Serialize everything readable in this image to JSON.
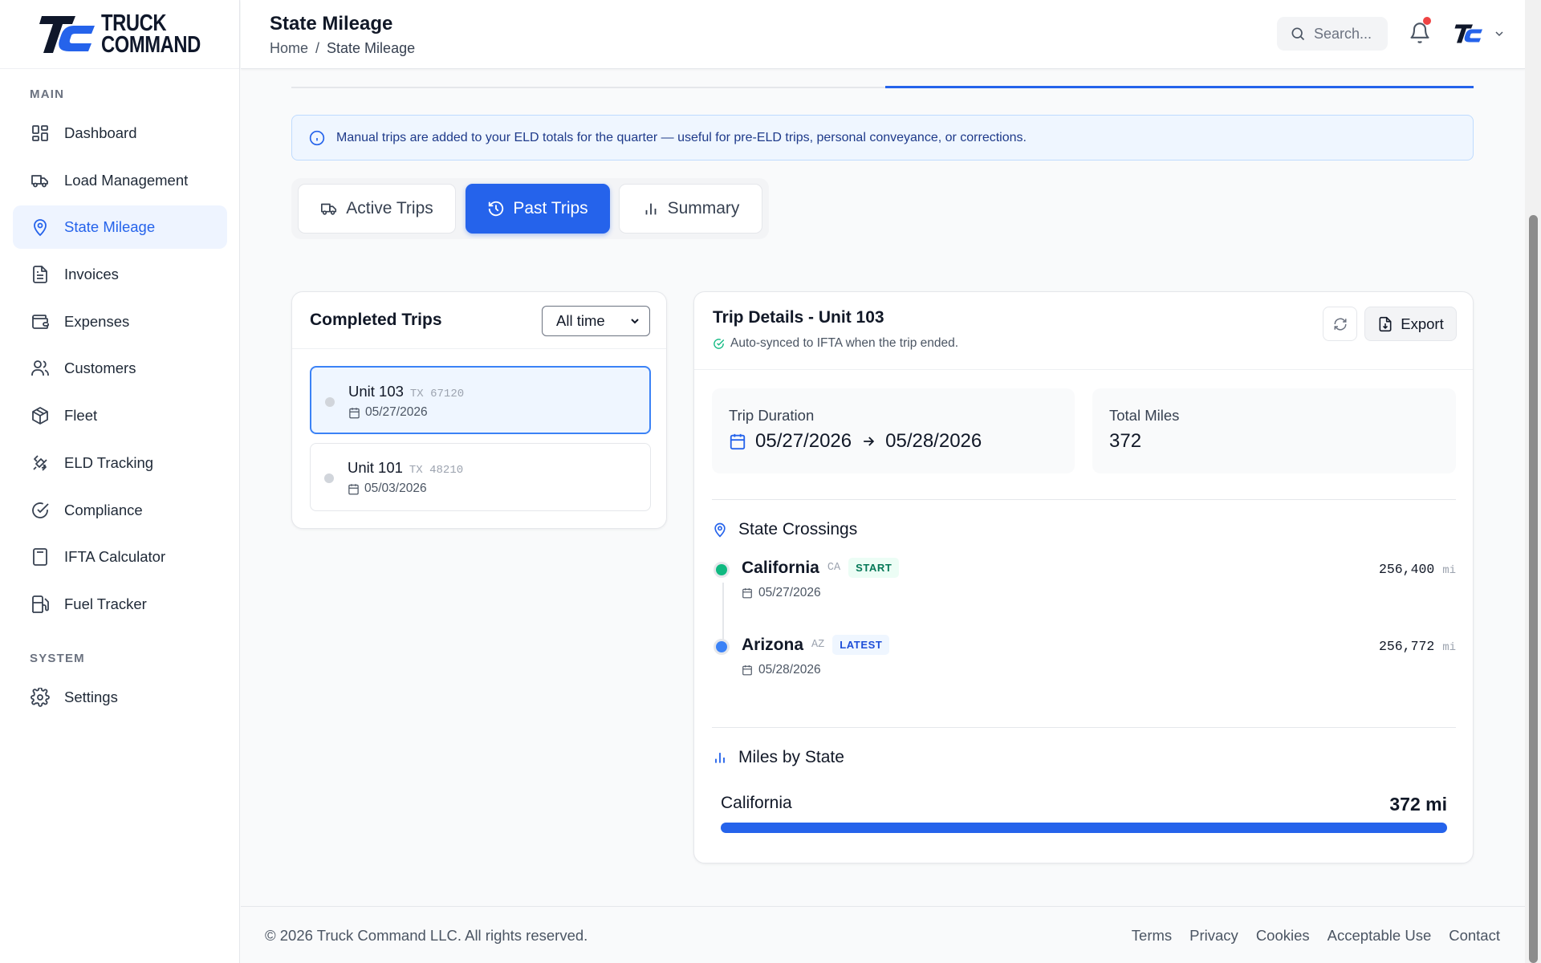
{
  "brand": {
    "line1": "TRUCK",
    "line2": "COMMAND",
    "accent": "#2563eb"
  },
  "sidebar": {
    "main_label": "MAIN",
    "system_label": "SYSTEM",
    "items": [
      {
        "label": "Dashboard",
        "icon": "dashboard-icon"
      },
      {
        "label": "Load Management",
        "icon": "truck-icon"
      },
      {
        "label": "State Mileage",
        "icon": "map-pin-icon",
        "active": true
      },
      {
        "label": "Invoices",
        "icon": "file-text-icon"
      },
      {
        "label": "Expenses",
        "icon": "wallet-icon"
      },
      {
        "label": "Customers",
        "icon": "users-icon"
      },
      {
        "label": "Fleet",
        "icon": "package-icon"
      },
      {
        "label": "ELD Tracking",
        "icon": "satellite-icon"
      },
      {
        "label": "Compliance",
        "icon": "check-circle-icon"
      },
      {
        "label": "IFTA Calculator",
        "icon": "calculator-icon"
      },
      {
        "label": "Fuel Tracker",
        "icon": "fuel-icon"
      }
    ],
    "system_items": [
      {
        "label": "Settings",
        "icon": "gear-icon"
      }
    ]
  },
  "header": {
    "title": "State Mileage",
    "breadcrumb": {
      "home": "Home",
      "separator": "/",
      "current": "State Mileage"
    },
    "search_placeholder": "Search...",
    "has_notification": true
  },
  "info_banner": "Manual trips are added to your ELD totals for the quarter — useful for pre-ELD trips, personal conveyance, or corrections.",
  "tabs": [
    {
      "label": "Active Trips",
      "icon": "truck-icon",
      "active": false
    },
    {
      "label": "Past Trips",
      "icon": "history-icon",
      "active": true
    },
    {
      "label": "Summary",
      "icon": "bar-chart-icon",
      "active": false
    }
  ],
  "trips_panel": {
    "title": "Completed Trips",
    "filter_value": "All time",
    "trips": [
      {
        "unit": "Unit 103",
        "plate": "TX 67120",
        "date": "05/27/2026",
        "selected": true
      },
      {
        "unit": "Unit 101",
        "plate": "TX 48210",
        "date": "05/03/2026",
        "selected": false
      }
    ]
  },
  "detail": {
    "title": "Trip Details - Unit 103",
    "sync_note": "Auto-synced to IFTA when the trip ended.",
    "export_label": "Export",
    "duration_label": "Trip Duration",
    "start_date": "05/27/2026",
    "end_date": "05/28/2026",
    "total_miles_label": "Total Miles",
    "total_miles": "372",
    "crossings_title": "State Crossings",
    "crossings": [
      {
        "state": "California",
        "abbr": "CA",
        "badge": "START",
        "date": "05/27/2026",
        "odometer": "256,400",
        "unit": "mi",
        "color": "#10b981"
      },
      {
        "state": "Arizona",
        "abbr": "AZ",
        "badge": "LATEST",
        "date": "05/28/2026",
        "odometer": "256,772",
        "unit": "mi",
        "color": "#3b82f6"
      }
    ],
    "miles_by_state_title": "Miles by State",
    "miles_by_state": [
      {
        "state": "California",
        "miles_label": "372 mi",
        "fraction": 1.0
      }
    ]
  },
  "footer": {
    "copyright": "© 2026 Truck Command LLC. All rights reserved.",
    "links": [
      "Terms",
      "Privacy",
      "Cookies",
      "Acceptable Use",
      "Contact"
    ]
  }
}
